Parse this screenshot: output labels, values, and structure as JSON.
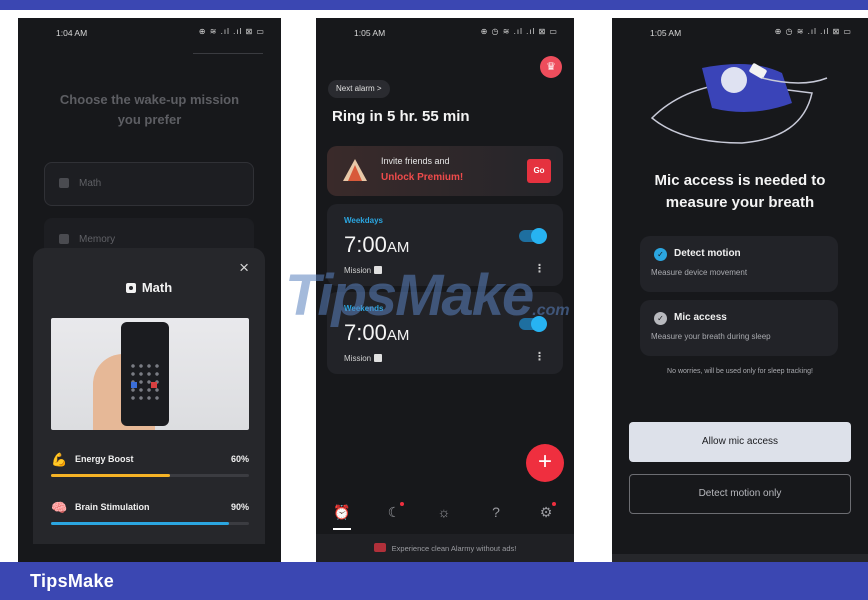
{
  "banner": {
    "brand": "TipsMake"
  },
  "watermark": {
    "text": "TipsMake",
    "suffix": ".com"
  },
  "phone1": {
    "status": {
      "time": "1:04 AM",
      "icons": "⊕ ≋ .ıl .ıl ⊠ ▭"
    },
    "title_line1": "Choose the wake-up mission",
    "title_line2": "you prefer",
    "options": [
      "Math",
      "Memory"
    ],
    "sheet": {
      "close": "×",
      "title": "Math",
      "stats": [
        {
          "icon": "💪",
          "name": "Energy Boost",
          "percent_label": "60%",
          "value": 0.6,
          "color": "#f5b326"
        },
        {
          "icon": "🧠",
          "name": "Brain Stimulation",
          "percent_label": "90%",
          "value": 0.9,
          "color": "#2ba6e0"
        }
      ]
    }
  },
  "phone2": {
    "status": {
      "time": "1:05 AM",
      "icons": "⊕ ◷ ≋ .ıl .ıl ⊠ ▭"
    },
    "crown": "♛",
    "next_alarm": "Next alarm >",
    "ring": "Ring in 5 hr. 55 min",
    "invite": {
      "line1": "Invite friends and",
      "line2": "Unlock Premium!",
      "go": "Go"
    },
    "alarms": [
      {
        "label": "Weekdays",
        "time": "7:00",
        "ampm": "AM",
        "mission": "Mission",
        "enabled": true
      },
      {
        "label": "Weekends",
        "time": "7:00",
        "ampm": "AM",
        "mission": "Mission",
        "enabled": true
      }
    ],
    "fab": "+",
    "more": "⋮",
    "nav": [
      {
        "icon": "alarm-clock-icon",
        "glyph": "⏰",
        "active": true,
        "dot": false
      },
      {
        "icon": "sleep-icon",
        "glyph": "☾",
        "active": false,
        "dot": true
      },
      {
        "icon": "sun-icon",
        "glyph": "☼",
        "active": false,
        "dot": false
      },
      {
        "icon": "help-icon",
        "glyph": "?",
        "active": false,
        "dot": false
      },
      {
        "icon": "settings-icon",
        "glyph": "⚙",
        "active": false,
        "dot": true
      }
    ],
    "ad_text": "Experience clean Alarmy without ads!"
  },
  "phone3": {
    "status": {
      "time": "1:05 AM",
      "icons": "⊕ ◷ ≋ .ıl .ıl ⊠ ▭"
    },
    "title_line1": "Mic access is needed to",
    "title_line2": "measure your breath",
    "permissions": [
      {
        "name": "Detect motion",
        "desc": "Measure device movement",
        "color": "#2ba6e0"
      },
      {
        "name": "Mic access",
        "desc": "Measure your breath during sleep",
        "color": "#b8b9be"
      }
    ],
    "note": "No worries, will be used only for sleep tracking!",
    "allow_button": "Allow mic access",
    "detect_button": "Detect motion only"
  }
}
